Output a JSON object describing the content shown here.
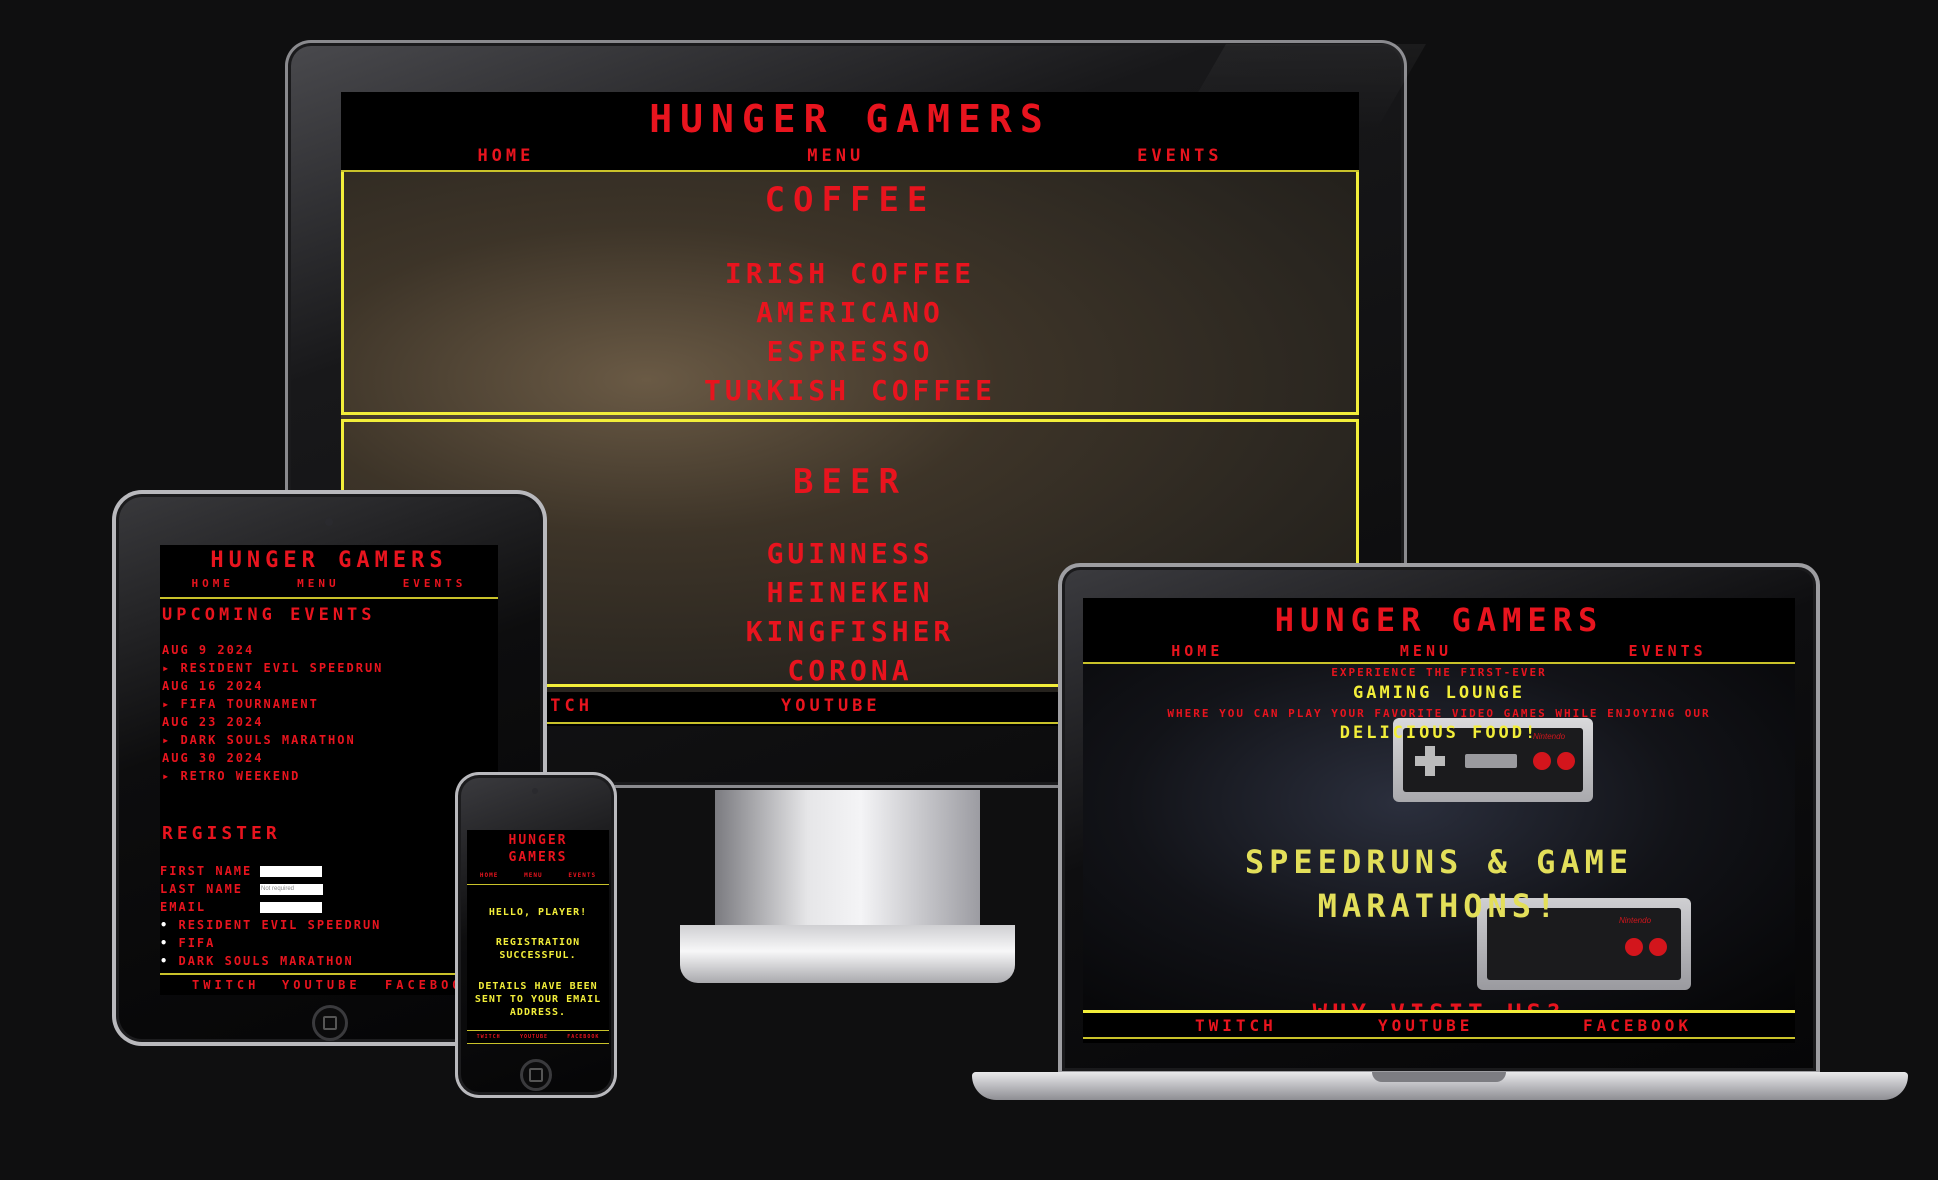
{
  "brand": "HUNGER GAMERS",
  "brand_phone": [
    "HUNGER",
    "GAMERS"
  ],
  "nav": {
    "home": "HOME",
    "menu": "MENU",
    "events": "EVENTS"
  },
  "footer": {
    "twitch": "TWITCH",
    "youtube": "YOUTUBE",
    "facebook": "FACEBOOK"
  },
  "monitor": {
    "coffee": {
      "heading": "COFFEE",
      "items": [
        "IRISH COFFEE",
        "AMERICANO",
        "ESPRESSO",
        "TURKISH COFFEE"
      ]
    },
    "beer": {
      "heading": "BEER",
      "items": [
        "GUINNESS",
        "HEINEKEN",
        "KINGFISHER",
        "CORONA"
      ]
    },
    "footer_twitch": "ITCH"
  },
  "tablet": {
    "events_heading": "UPCOMING EVENTS",
    "events": [
      {
        "date": "AUG 9 2024",
        "title": "RESIDENT EVIL SPEEDRUN"
      },
      {
        "date": "AUG 16 2024",
        "title": "FIFA TOURNAMENT"
      },
      {
        "date": "AUG 23 2024",
        "title": "DARK SOULS MARATHON"
      },
      {
        "date": "AUG 30 2024",
        "title": "RETRO WEEKEND"
      }
    ],
    "register_heading": "REGISTER",
    "form": {
      "first_name_label": "FIRST NAME",
      "last_name_label": "LAST NAME",
      "last_name_placeholder": "Not required",
      "email_label": "EMAIL"
    },
    "options": [
      "RESIDENT EVIL SPEEDRUN",
      "FIFA",
      "DARK SOULS MARATHON"
    ],
    "footer_facebook": "FACEBOO"
  },
  "phone": {
    "greeting": "HELLO, PLAYER!",
    "success": "REGISTRATION SUCCESSFUL.",
    "details": "DETAILS HAVE BEEN SENT TO YOUR EMAIL ADDRESS."
  },
  "laptop": {
    "intro_line1": "EXPERIENCE THE FIRST-EVER",
    "intro_highlight1": "GAMING LOUNGE",
    "intro_line2": "WHERE YOU CAN PLAY YOUR FAVORITE VIDEO GAMES WHILE ENJOYING OUR",
    "intro_highlight2": "DELICIOUS FOOD!",
    "hero": "SPEEDRUNS & GAME MARATHONS!",
    "why": "WHY VISIT US?",
    "controller_brand": "Nintendo"
  }
}
